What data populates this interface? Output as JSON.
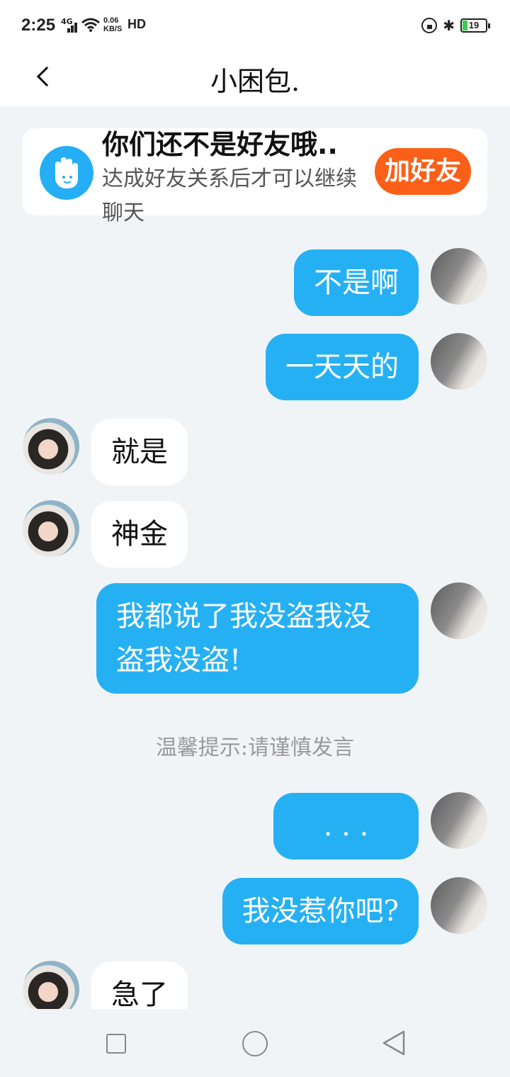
{
  "status_bar": {
    "time": "2:25",
    "network": "4G",
    "speed_value": "0.06",
    "speed_unit": "KB/S",
    "hd": "HD",
    "battery": "19"
  },
  "header": {
    "title": "小困包."
  },
  "friend_notice": {
    "title": "你们还不是好友哦..",
    "description": "达成好友关系后才可以继续聊天",
    "add_button": "加好友"
  },
  "messages": [
    {
      "sender": "self",
      "text": "不是啊"
    },
    {
      "sender": "self",
      "text": "一天天的"
    },
    {
      "sender": "other",
      "text": "就是"
    },
    {
      "sender": "other",
      "text": "神金"
    },
    {
      "sender": "self",
      "text": "我都说了我没盗我没盗我没盗!"
    },
    {
      "sender": "self",
      "text": ". . ."
    },
    {
      "sender": "self",
      "text": "我没惹你吧?"
    },
    {
      "sender": "other",
      "text": "急了"
    }
  ],
  "system_notice": "温馨提示:请谨慎发言",
  "colors": {
    "bubble_self": "#26b0f4",
    "bubble_other": "#ffffff",
    "add_button": "#fa6018",
    "background": "#f1f4f7"
  },
  "icons": [
    "back-icon",
    "hand-icon",
    "wifi-icon",
    "bluetooth-icon",
    "lock-rotation-icon",
    "battery-icon",
    "recent-apps-icon",
    "home-icon",
    "back-nav-icon"
  ]
}
